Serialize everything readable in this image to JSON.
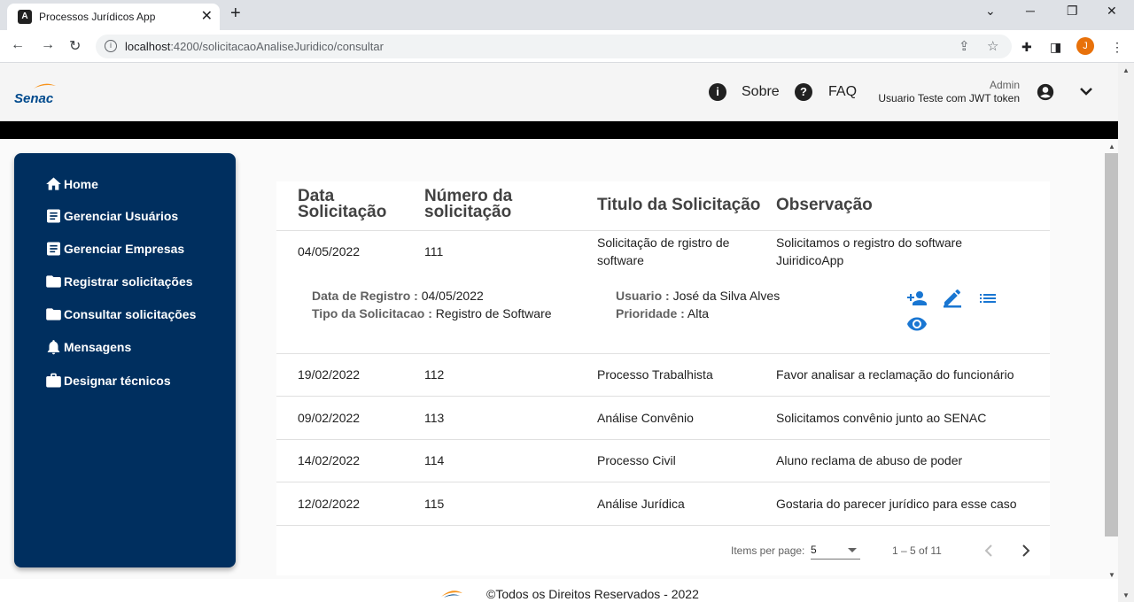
{
  "browser": {
    "tab_title": "Processos Jurídicos App",
    "url_host": "localhost",
    "url_path": ":4200/solicitacaoAnaliseJuridico/consultar",
    "profile_initial": "J"
  },
  "header": {
    "logo_text": "Senac",
    "about_label": "Sobre",
    "faq_label": "FAQ",
    "user_role": "Admin",
    "user_name": "Usuario Teste com JWT token"
  },
  "sidebar": {
    "items": [
      {
        "label": "Home",
        "icon": "home-icon"
      },
      {
        "label": "Gerenciar Usuários",
        "icon": "list-icon"
      },
      {
        "label": "Gerenciar Empresas",
        "icon": "list-icon"
      },
      {
        "label": "Registrar solicitações",
        "icon": "folder-icon"
      },
      {
        "label": "Consultar solicitações",
        "icon": "folder-icon"
      },
      {
        "label": "Mensagens",
        "icon": "bell-icon"
      },
      {
        "label": "Designar técnicos",
        "icon": "briefcase-icon"
      }
    ]
  },
  "table": {
    "headers": {
      "date_1": "Data",
      "date_2": "Solicitação",
      "number_1": "Número da",
      "number_2": "solicitação",
      "title": "Titulo da Solicitação",
      "note": "Observação"
    },
    "rows": [
      {
        "date": "04/05/2022",
        "number": "111",
        "title_1": "Solicitação de rgistro de",
        "title_2": "software",
        "note_1": "Solicitamos o registro do software",
        "note_2": "JuiridicoApp"
      },
      {
        "date": "19/02/2022",
        "number": "112",
        "title": "Processo Trabalhista",
        "note": "Favor analisar a reclamação do funcionário"
      },
      {
        "date": "09/02/2022",
        "number": "113",
        "title": "Análise Convênio",
        "note": "Solicitamos convênio junto ao SENAC"
      },
      {
        "date": "14/02/2022",
        "number": "114",
        "title": "Processo Civil",
        "note": "Aluno reclama de abuso de poder"
      },
      {
        "date": "12/02/2022",
        "number": "115",
        "title": "Análise Jurídica",
        "note": "Gostaria do parecer jurídico para esse caso"
      }
    ],
    "detail": {
      "reg_label": "Data de Registro :",
      "reg_value": "04/05/2022",
      "type_label": "Tipo da Solicitacao :",
      "type_value": "Registro de Software",
      "user_label": "Usuario :",
      "user_value": "José da Silva Alves",
      "priority_label": "Prioridade :",
      "priority_value": "Alta"
    }
  },
  "paginator": {
    "items_label": "Items per page:",
    "page_size": "5",
    "range": "1 – 5 of 11"
  },
  "footer": {
    "text": "©Todos os Direitos Reservados - 2022"
  },
  "colors": {
    "sidebar_bg": "#002f5f",
    "action_icon": "#1976d2",
    "header_bg": "#f5f5f5"
  }
}
